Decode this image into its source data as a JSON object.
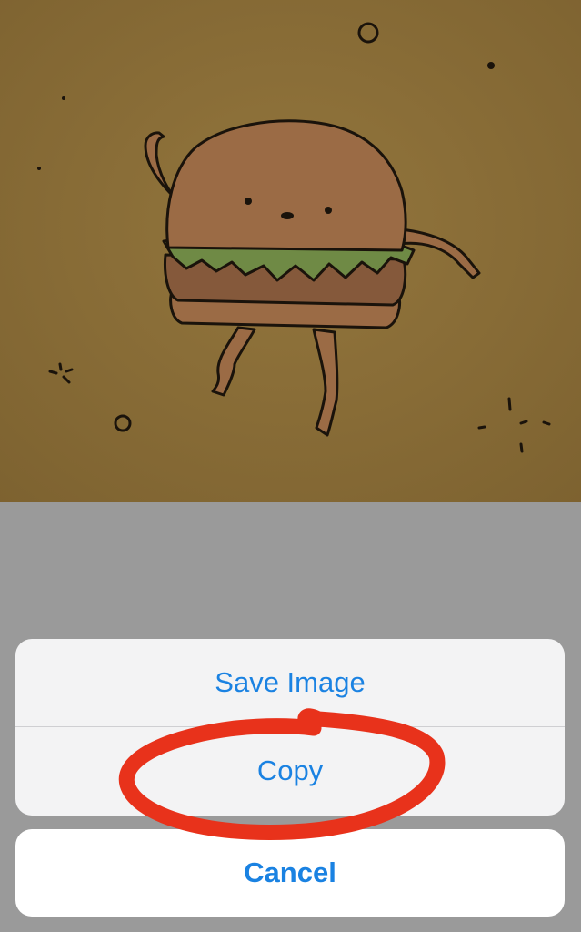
{
  "photo": {
    "subject": "dancing hamburger doodle",
    "colors": {
      "background": "#8c7039",
      "bun": "#9b6b45",
      "lettuce": "#6f8a45",
      "patty": "#85593b",
      "line": "#1a130b"
    }
  },
  "action_sheet": {
    "items": [
      {
        "label": "Save Image"
      },
      {
        "label": "Copy"
      }
    ],
    "cancel_label": "Cancel",
    "accent_color": "#1a82e2"
  },
  "annotation": {
    "kind": "red-circle-highlight",
    "color": "#e8321b",
    "target": "Copy"
  }
}
